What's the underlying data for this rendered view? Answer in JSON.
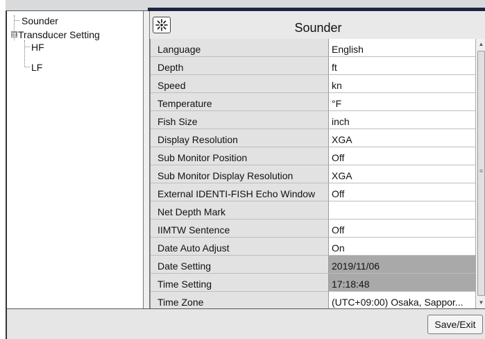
{
  "tree": {
    "items": [
      {
        "label": "Sounder",
        "selected": true
      },
      {
        "label": "Transducer Setting",
        "expanded": true,
        "children": [
          "HF",
          "LF"
        ]
      }
    ],
    "expander_glyph": "⊟"
  },
  "panel": {
    "title": "Sounder",
    "icon": "sounder-settings-icon"
  },
  "settings": [
    {
      "label": "Language",
      "value": "English"
    },
    {
      "label": "Depth",
      "value": "ft"
    },
    {
      "label": "Speed",
      "value": "kn"
    },
    {
      "label": "Temperature",
      "value": "°F"
    },
    {
      "label": "Fish Size",
      "value": "inch"
    },
    {
      "label": "Display Resolution",
      "value": "XGA"
    },
    {
      "label": "Sub Monitor Position",
      "value": "Off"
    },
    {
      "label": "Sub Monitor Display Resolution",
      "value": "XGA"
    },
    {
      "label": "External IDENTI-FISH Echo Window",
      "value": "Off"
    },
    {
      "label": "Net Depth Mark",
      "value": ""
    },
    {
      "label": "IIMTW Sentence",
      "value": "Off"
    },
    {
      "label": "Date Auto Adjust",
      "value": "On"
    },
    {
      "label": "Date Setting",
      "value": "2019/11/06",
      "disabled": true
    },
    {
      "label": "Time Setting",
      "value": "17:18:48",
      "disabled": true
    },
    {
      "label": "Time Zone",
      "value": "(UTC+09:00) Osaka, Sappor..."
    }
  ],
  "footer": {
    "save_label": "Save/Exit"
  }
}
